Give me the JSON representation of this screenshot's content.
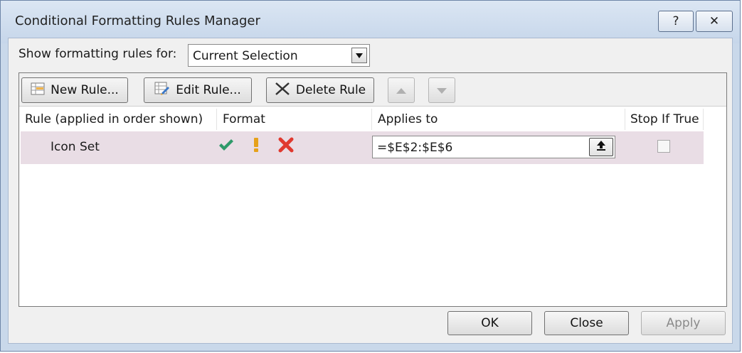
{
  "window": {
    "title": "Conditional Formatting Rules Manager",
    "help_label": "?",
    "close_label": "✕"
  },
  "filter": {
    "label": "Show formatting rules for:",
    "selected": "Current Selection"
  },
  "toolbar": {
    "new_rule": "New Rule...",
    "edit_rule": "Edit Rule...",
    "delete_rule": "Delete Rule"
  },
  "table": {
    "headers": [
      "Rule (applied in order shown)",
      "Format",
      "Applies to",
      "Stop If True"
    ],
    "rows": [
      {
        "rule": "Icon Set",
        "format_icons": [
          "green-check-icon",
          "yellow-exclamation-icon",
          "red-x-icon"
        ],
        "applies_to": "=$E$2:$E$6",
        "stop_if_true": false
      }
    ]
  },
  "footer": {
    "ok": "OK",
    "close": "Close",
    "apply": "Apply"
  },
  "colors": {
    "check": "#2e9a6a",
    "exclamation": "#e6a11a",
    "x": "#e0392f",
    "row_highlight": "#e9dde5"
  }
}
